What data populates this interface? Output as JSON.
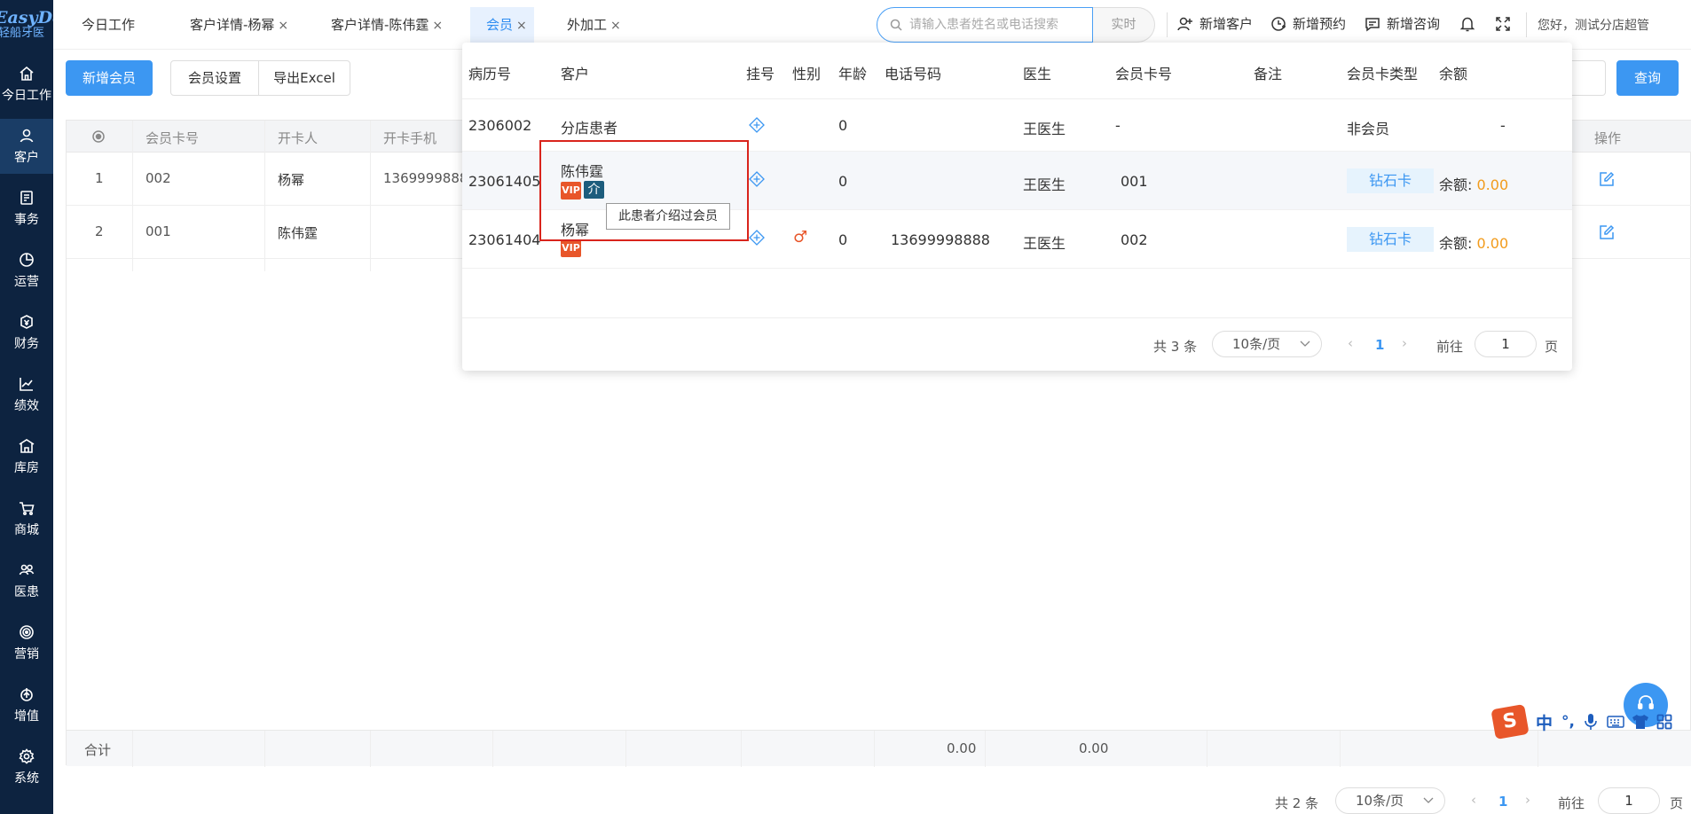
{
  "logo": {
    "line1": "EasyDent",
    "line2": "轻船牙医"
  },
  "sidebar": {
    "items": [
      {
        "label": "今日工作",
        "icon": "home-icon"
      },
      {
        "label": "客户",
        "icon": "user-icon",
        "active": true
      },
      {
        "label": "事务",
        "icon": "task-icon"
      },
      {
        "label": "运营",
        "icon": "pie-icon"
      },
      {
        "label": "财务",
        "icon": "finance-icon"
      },
      {
        "label": "绩效",
        "icon": "chart-icon"
      },
      {
        "label": "库房",
        "icon": "warehouse-icon"
      },
      {
        "label": "商城",
        "icon": "cart-icon"
      },
      {
        "label": "医患",
        "icon": "people-icon"
      },
      {
        "label": "营销",
        "icon": "target-icon"
      },
      {
        "label": "增值",
        "icon": "value-icon"
      },
      {
        "label": "系统",
        "icon": "gear-icon"
      }
    ]
  },
  "tabs": [
    {
      "label": "今日工作",
      "closable": false
    },
    {
      "label": "客户详情-杨幂",
      "closable": true
    },
    {
      "label": "客户详情-陈伟霆",
      "closable": true
    },
    {
      "label": "会员",
      "closable": true,
      "active": true
    },
    {
      "label": "外加工",
      "closable": true
    }
  ],
  "tab_close": "×",
  "search": {
    "placeholder": "请输入患者姓名或电话搜索",
    "realtime": "实时"
  },
  "top_actions": {
    "add_customer": "新增客户",
    "add_appointment": "新增预约",
    "add_consult": "新增咨询",
    "greeting": "您好，测试分店超管"
  },
  "toolbar": {
    "add_member": "新增会员",
    "member_settings": "会员设置",
    "export_excel": "导出Excel",
    "query": "查询"
  },
  "main_table": {
    "headers": [
      "会员卡号",
      "开卡人",
      "开卡手机"
    ],
    "action_header": "操作",
    "rows": [
      {
        "index": "1",
        "card_no": "002",
        "holder": "杨幂",
        "phone": "13699998888"
      },
      {
        "index": "2",
        "card_no": "001",
        "holder": "陈伟霆",
        "phone": ""
      }
    ],
    "summary": {
      "label": "合计",
      "value1": "0.00",
      "value2": "0.00"
    }
  },
  "main_pager": {
    "total": "共 2 条",
    "page_size": "10条/页",
    "current": "1",
    "goto_label": "前往",
    "goto_value": "1",
    "page_suffix": "页"
  },
  "popup": {
    "headers": [
      "病历号",
      "客户",
      "挂号",
      "性别",
      "年龄",
      "电话号码",
      "医生",
      "会员卡号",
      "备注",
      "会员卡类型",
      "余额"
    ],
    "rows": [
      {
        "record_no": "2306002",
        "customer": "分店患者",
        "gender": "",
        "age": "0",
        "phone": "",
        "doctor": "王医生",
        "card_no": "-",
        "remark": "",
        "card_type": "非会员",
        "balance": "-"
      },
      {
        "record_no": "23061405",
        "customer": "陈伟霆",
        "gender": "",
        "age": "0",
        "phone": "",
        "doctor": "王医生",
        "card_no": "001",
        "remark": "",
        "card_type": "钻石卡",
        "balance_label": "余额:",
        "balance": "0.00"
      },
      {
        "record_no": "23061404",
        "customer": "杨幂",
        "gender": "♂",
        "age": "0",
        "phone": "13699998888",
        "doctor": "王医生",
        "card_no": "002",
        "remark": "",
        "card_type": "钻石卡",
        "balance_label": "余额:",
        "balance": "0.00"
      }
    ],
    "badges": {
      "vip": "VIP",
      "jie": "介"
    },
    "tooltip": "此患者介绍过会员",
    "pager": {
      "total": "共 3 条",
      "page_size": "10条/页",
      "current": "1",
      "goto_label": "前往",
      "goto_value": "1",
      "page_suffix": "页"
    }
  },
  "ime": {
    "chars": [
      "中",
      "°,"
    ]
  },
  "colors": {
    "primary": "#3c97f2",
    "sidebar": "#0d2340",
    "vip": "#e8562a",
    "jie": "#1d5d7d",
    "amount": "#f29b1b",
    "highlight": "#d9241c"
  }
}
